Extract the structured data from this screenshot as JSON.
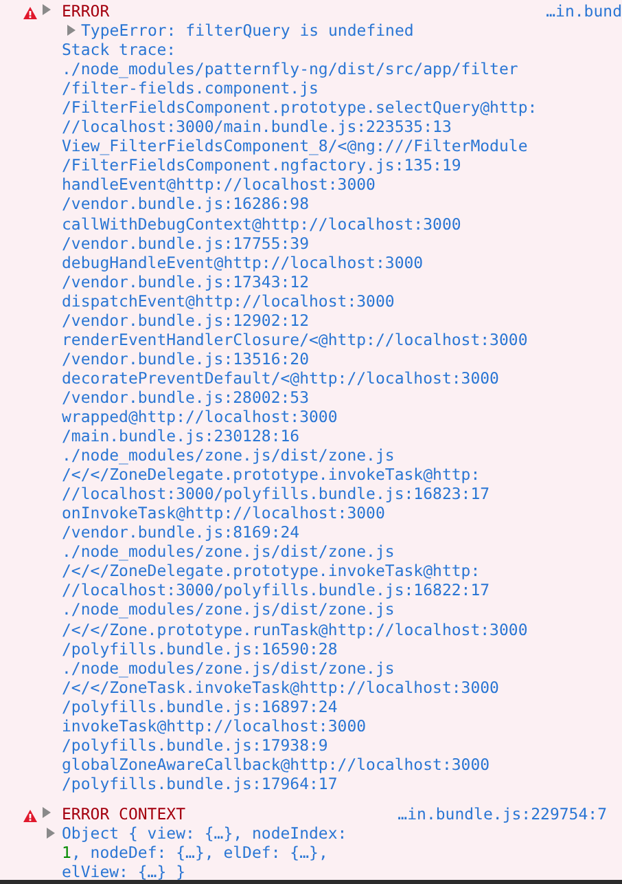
{
  "messages": [
    {
      "kind": "error",
      "label": "ERROR",
      "source": "…in.bund",
      "expanded": false,
      "summary": {
        "expanded": false,
        "text": "TypeError: filterQuery is undefined"
      },
      "lines": [
        "Stack trace:",
        "./node_modules/patternfly-ng/dist/src/app/filter",
        "/filter-fields.component.js",
        "/FilterFieldsComponent.prototype.selectQuery@http:",
        "//localhost:3000/main.bundle.js:223535:13",
        "View_FilterFieldsComponent_8/<@ng:///FilterModule",
        "/FilterFieldsComponent.ngfactory.js:135:19",
        "handleEvent@http://localhost:3000",
        "/vendor.bundle.js:16286:98",
        "callWithDebugContext@http://localhost:3000",
        "/vendor.bundle.js:17755:39",
        "debugHandleEvent@http://localhost:3000",
        "/vendor.bundle.js:17343:12",
        "dispatchEvent@http://localhost:3000",
        "/vendor.bundle.js:12902:12",
        "renderEventHandlerClosure/<@http://localhost:3000",
        "/vendor.bundle.js:13516:20",
        "decoratePreventDefault/<@http://localhost:3000",
        "/vendor.bundle.js:28002:53",
        "wrapped@http://localhost:3000",
        "/main.bundle.js:230128:16",
        "./node_modules/zone.js/dist/zone.js",
        "/</</ZoneDelegate.prototype.invokeTask@http:",
        "//localhost:3000/polyfills.bundle.js:16823:17",
        "onInvokeTask@http://localhost:3000",
        "/vendor.bundle.js:8169:24",
        "./node_modules/zone.js/dist/zone.js",
        "/</</ZoneDelegate.prototype.invokeTask@http:",
        "//localhost:3000/polyfills.bundle.js:16822:17",
        "./node_modules/zone.js/dist/zone.js",
        "/</</Zone.prototype.runTask@http://localhost:3000",
        "/polyfills.bundle.js:16590:28",
        "./node_modules/zone.js/dist/zone.js",
        "/</</ZoneTask.invokeTask@http://localhost:3000",
        "/polyfills.bundle.js:16897:24",
        "invokeTask@http://localhost:3000",
        "/polyfills.bundle.js:17938:9",
        "globalZoneAwareCallback@http://localhost:3000",
        "/polyfills.bundle.js:17964:17"
      ]
    },
    {
      "kind": "error",
      "label": "ERROR CONTEXT",
      "source": "…in.bundle.js:229754:7",
      "expanded": false,
      "object": {
        "expanded": false,
        "parts": [
          {
            "kind": "plain",
            "text": "Object { view: {…}, nodeIndex: "
          },
          {
            "kind": "number",
            "text": "1"
          },
          {
            "kind": "plain",
            "text": ", nodeDef: {…}, elDef: {…}, elView: {…} }"
          }
        ]
      }
    }
  ]
}
